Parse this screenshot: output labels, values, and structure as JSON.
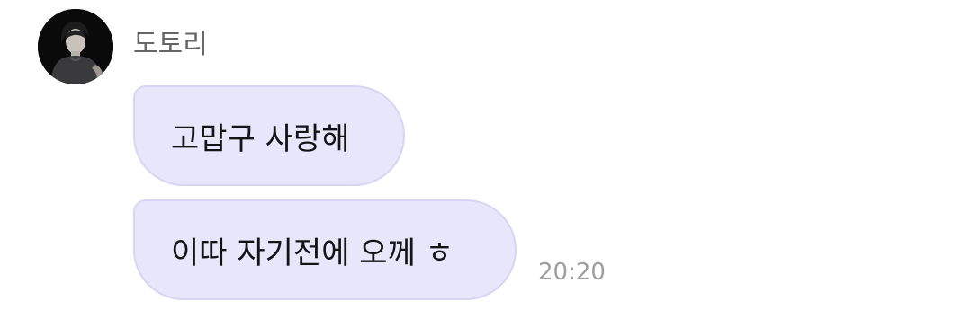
{
  "sender": {
    "name": "도토리",
    "avatar_icon": "profile-photo-icon"
  },
  "messages": [
    {
      "text": "고맙구 사랑해"
    },
    {
      "text": "이따 자기전에 오께 ㅎ"
    }
  ],
  "timestamp": "20:20",
  "colors": {
    "bubble_bg": "#e8e6fb",
    "bubble_border": "#d8d5f2",
    "name_text": "#666666",
    "time_text": "#9e9e9e"
  }
}
